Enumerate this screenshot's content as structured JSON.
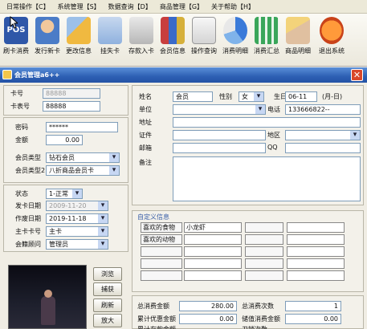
{
  "menu": [
    "日常操作【C】",
    "系统管理【S】",
    "数据查询【D】",
    "商品管理【G】",
    "关于帮助【H】"
  ],
  "toolbar": [
    "刷卡消费",
    "发行新卡",
    "更改信息",
    "挂失卡",
    "存款入卡",
    "会员信息",
    "操作查询",
    "消费明细",
    "消费汇总",
    "商品明细",
    "退出系统"
  ],
  "toolbar_icon_names": [
    "pos-card-icon",
    "new-card-icon",
    "edit-info-icon",
    "lost-card-icon",
    "deposit-icon",
    "member-info-icon",
    "operation-query-icon",
    "consume-detail-icon",
    "consume-summary-icon",
    "product-detail-icon",
    "exit-system-icon"
  ],
  "window": {
    "title": "会员管理a6++",
    "close": "✕"
  },
  "card": {
    "card_no_label": "卡号",
    "card_no_value": "88888",
    "card_face_label": "卡表号",
    "card_face_value": "88888"
  },
  "account": {
    "password_label": "密码",
    "password_value": "******",
    "balance_label": "金额",
    "balance_value": "0.00",
    "type_label": "会员类型",
    "type_value": "钻石会员",
    "type2_label": "会员类型2",
    "type2_value": "八折商品会员卡"
  },
  "status": {
    "state_label": "状态",
    "state_value": "1-正常",
    "issue_label": "发卡日期",
    "issue_value": "2009-11-20",
    "valid_label": "作废日期",
    "valid_value": "2019-11-18",
    "main_card_label": "主卡卡号",
    "main_card_value": "主卡",
    "consultant_label": "会籍顾问",
    "consultant_value": "管理员"
  },
  "photo_buttons": {
    "browse": "浏览",
    "capture": "捕获",
    "refresh": "刷新",
    "enlarge": "放大"
  },
  "person": {
    "name_label": "姓名",
    "name_value": "会员",
    "gender_label": "性别",
    "gender_value": "女",
    "birthday_label": "生日",
    "birthday_value": "06-11",
    "birthday_hint": "(月-日)",
    "unit_label": "单位",
    "phone_label": "电话",
    "phone_value": "133666822--",
    "address_label": "地址",
    "id_label": "证件",
    "region_label": "地区",
    "postal_label": "邮箱",
    "qq_label": "QQ",
    "note_label": "备注"
  },
  "custom": {
    "title": "自定义信息",
    "rows": [
      [
        "喜欢的食物",
        "小龙虾"
      ],
      [
        "喜欢的动物",
        ""
      ],
      [
        "",
        ""
      ],
      [
        "",
        ""
      ],
      [
        "",
        ""
      ]
    ]
  },
  "summary": {
    "total_label": "总消费金额",
    "total_value": "280.00",
    "count_label": "总消费次数",
    "count_value": "1",
    "discount_label": "累计优惠金额",
    "discount_value": "0.00",
    "store_label": "储值消费金额",
    "store_value": "0.00",
    "extra1_label": "累计存款金额",
    "extra2_label": "卫销次数"
  },
  "colors": {
    "title_bar": "#2d5fb3",
    "background": "#f0ede4",
    "panel_border": "#b9b6a8",
    "custom_title": "#3a5fa8"
  }
}
